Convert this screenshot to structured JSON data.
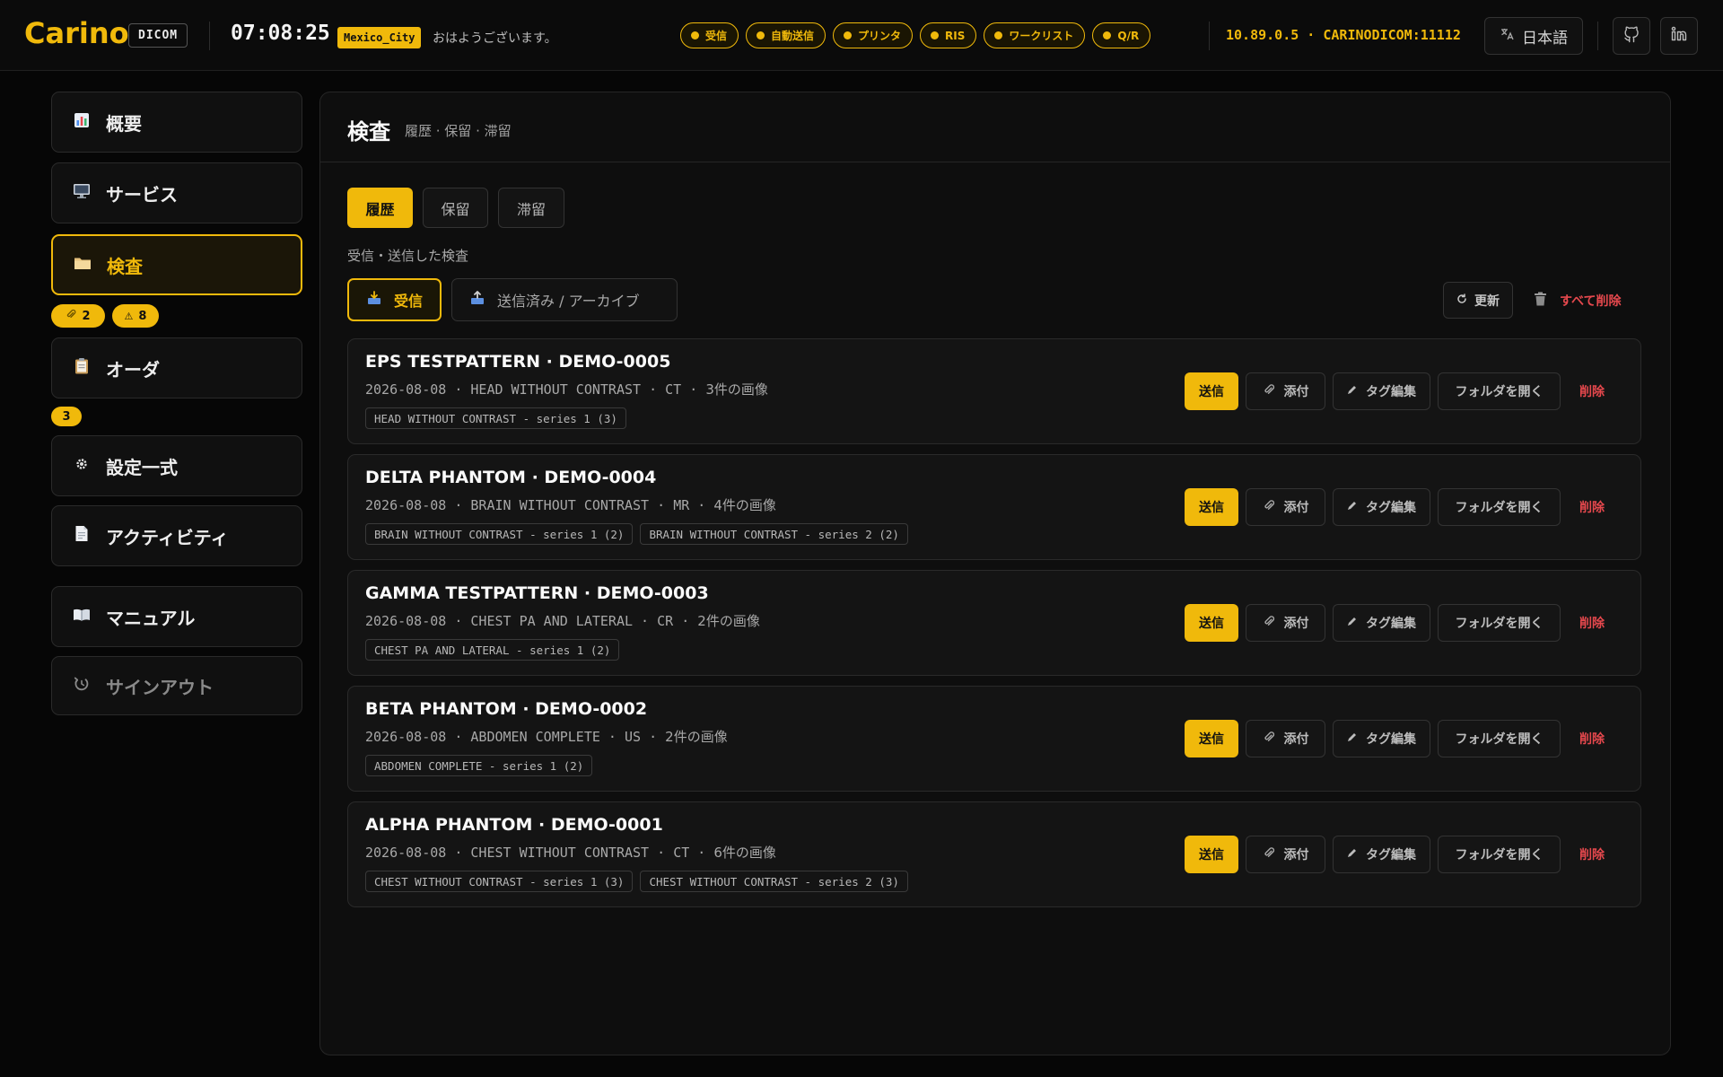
{
  "header": {
    "logo": "Carino",
    "product_badge": "DICOM",
    "clock": "07:08:25",
    "timezone": "Mexico_City",
    "greeting": "おはようございます。",
    "services": [
      "受信",
      "自動送信",
      "プリンタ",
      "RIS",
      "ワークリスト",
      "Q/R"
    ],
    "address": "10.89.0.5 · CARINODICOM:11112",
    "language": "日本語",
    "icons": [
      "translate-icon",
      "github-icon",
      "linkedin-icon"
    ]
  },
  "sidebar": {
    "items": [
      {
        "label": "概要",
        "icon": "chart-icon"
      },
      {
        "label": "サービス",
        "icon": "monitor-icon"
      },
      {
        "label": "検査",
        "icon": "folder-icon"
      },
      {
        "label": "オーダ",
        "icon": "clipboard-icon"
      },
      {
        "label": "設定一式",
        "icon": "gear-icon"
      },
      {
        "label": "アクティビティ",
        "icon": "document-icon"
      },
      {
        "label": "マニュアル",
        "icon": "book-icon"
      },
      {
        "label": "サインアウト",
        "icon": "signout-icon"
      }
    ],
    "exam_badges": {
      "attachments": "2",
      "warnings": "8"
    },
    "order_badge": "3"
  },
  "main": {
    "title": "検査",
    "subtitle": "履歴 · 保留 · 滞留",
    "segments": [
      "履歴",
      "保留",
      "滞留"
    ],
    "segment_hint": "受信・送信した検査",
    "tabs": [
      "受信",
      "送信済み / アーカイブ"
    ],
    "refresh": "更新",
    "delete_all": "すべて削除",
    "action_labels": {
      "send": "送信",
      "attach": "添付",
      "edit_tags": "タグ編集",
      "open_folder": "フォルダを開く",
      "delete": "削除"
    },
    "studies": [
      {
        "title": "EPS TESTPATTERN · DEMO-0005",
        "date": "2026-08-08",
        "description": "HEAD WITHOUT CONTRAST",
        "modality": "CT",
        "images": "3件の画像",
        "series": [
          "HEAD WITHOUT CONTRAST - series 1 (3)"
        ]
      },
      {
        "title": "DELTA PHANTOM · DEMO-0004",
        "date": "2026-08-08",
        "description": "BRAIN WITHOUT CONTRAST",
        "modality": "MR",
        "images": "4件の画像",
        "series": [
          "BRAIN WITHOUT CONTRAST - series 1 (2)",
          "BRAIN WITHOUT CONTRAST - series 2 (2)"
        ]
      },
      {
        "title": "GAMMA TESTPATTERN · DEMO-0003",
        "date": "2026-08-08",
        "description": "CHEST PA AND LATERAL",
        "modality": "CR",
        "images": "2件の画像",
        "series": [
          "CHEST PA AND LATERAL - series 1 (2)"
        ]
      },
      {
        "title": "BETA PHANTOM · DEMO-0002",
        "date": "2026-08-08",
        "description": "ABDOMEN COMPLETE",
        "modality": "US",
        "images": "2件の画像",
        "series": [
          "ABDOMEN COMPLETE - series 1 (2)"
        ]
      },
      {
        "title": "ALPHA PHANTOM · DEMO-0001",
        "date": "2026-08-08",
        "description": "CHEST WITHOUT CONTRAST",
        "modality": "CT",
        "images": "6件の画像",
        "series": [
          "CHEST WITHOUT CONTRAST - series 1 (3)",
          "CHEST WITHOUT CONTRAST - series 2 (3)"
        ]
      }
    ]
  },
  "colors": {
    "accent": "#f0b90b",
    "danger": "#e5484d",
    "background": "#060606"
  }
}
